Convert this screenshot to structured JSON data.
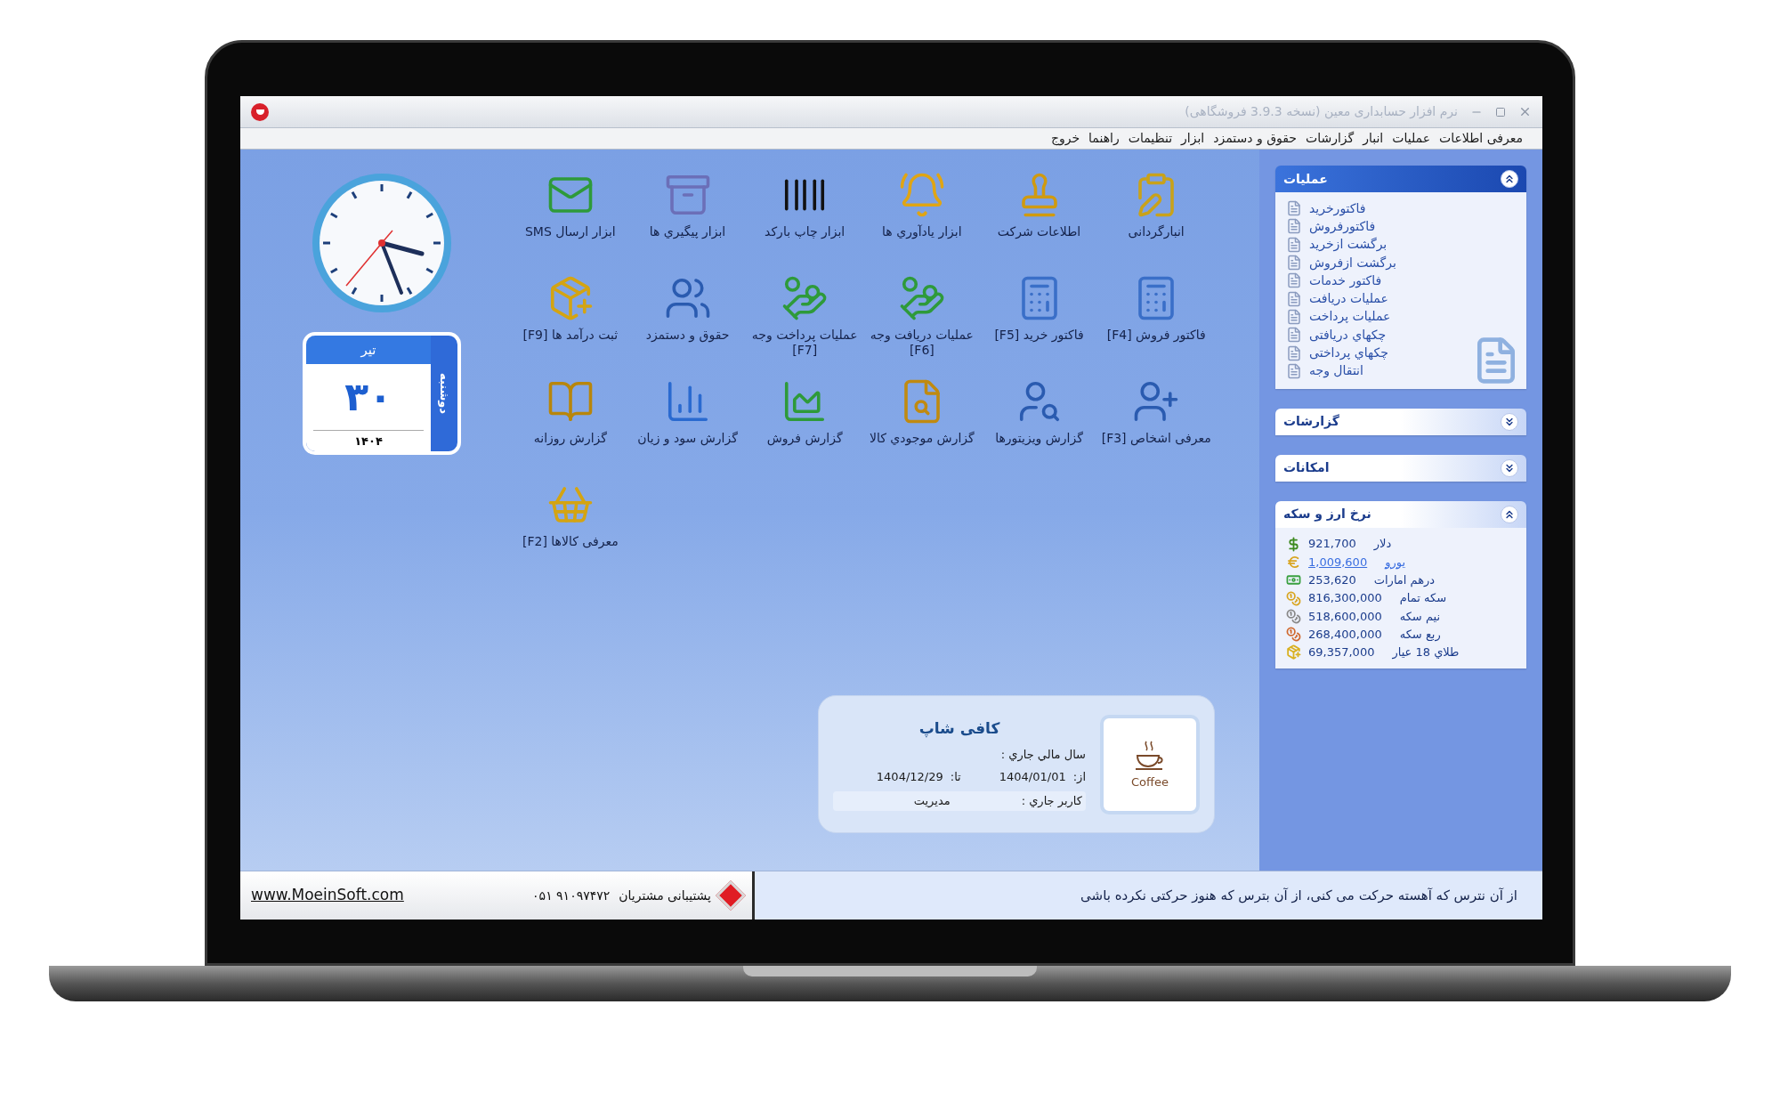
{
  "window": {
    "title": "نرم افزار حسابداری معین (نسخه 3.9.3 فروشگاهی)"
  },
  "menu": [
    "معرفی اطلاعات",
    "عملیات",
    "انبار",
    "گزارشات",
    "حقوق و دستمزد",
    "ابزار",
    "تنظیمات",
    "راهنما",
    "خروج"
  ],
  "shortcuts": [
    {
      "label": "انبارگردانی"
    },
    {
      "label": "اطلاعات شرکت"
    },
    {
      "label": "ابزار يادآوري ها"
    },
    {
      "label": "ابزار چاپ بارکد"
    },
    {
      "label": "ابزار پیگیري ها"
    },
    {
      "label": "ابزار ارسال SMS"
    },
    {
      "label": "فاکتور فروش [F4]"
    },
    {
      "label": "فاکتور خرید [F5]"
    },
    {
      "label": "عملیات دریافت وجه [F6]"
    },
    {
      "label": "عملیات پرداخت وجه [F7]"
    },
    {
      "label": "حقوق و دستمزد"
    },
    {
      "label": "ثبت درآمد ها [F9]"
    },
    {
      "label": "معرفی اشخاص [F3]"
    },
    {
      "label": "گزارش ویزیتورها"
    },
    {
      "label": "گزارش موجودي کالا"
    },
    {
      "label": "گزارش فروش"
    },
    {
      "label": "گزارش سود و زیان"
    },
    {
      "label": "گزارش روزانه"
    },
    {
      "label": "معرفی کالاها [F2]"
    }
  ],
  "calendar": {
    "month": "تیر",
    "day": "۳۰",
    "year": "۱۴۰۴",
    "weekday": "دوشنبه"
  },
  "company_card": {
    "name": "کافی شاپ",
    "fiscal_year_label": "سال مالي جاري :",
    "from_label": "از:",
    "from_date": "1404/01/01",
    "to_label": "تا:",
    "to_date": "1404/12/29",
    "user_label": "کاربر جاري :",
    "user": "مدیریت",
    "logo_text": "Coffee"
  },
  "sidebar": {
    "panels": [
      {
        "kind": "links",
        "title": "عملیات",
        "expanded": true,
        "items": [
          "فاکتورخرید",
          "فاکتورفروش",
          "برگشت ازخرید",
          "برگشت ازفروش",
          "فاکتور خدمات",
          "عملیات دریافت",
          "عملیات پرداخت",
          "چکهاي دریافتی",
          "چکهاي پرداختی",
          "انتقال وجه"
        ]
      },
      {
        "kind": "links",
        "title": "گزارشات",
        "expanded": false
      },
      {
        "kind": "links",
        "title": "امکانات",
        "expanded": false
      },
      {
        "kind": "rates",
        "title": "نرخ ارز و سکه",
        "expanded": true,
        "rates": [
          {
            "name": "دلار",
            "value": "921,700",
            "hovered": false
          },
          {
            "name": "یورو",
            "value": "1,009,600",
            "hovered": true
          },
          {
            "name": "درهم امارات",
            "value": "253,620",
            "hovered": false
          },
          {
            "name": "سکه تمام",
            "value": "816,300,000",
            "hovered": false
          },
          {
            "name": "نیم سکه",
            "value": "518,600,000",
            "hovered": false
          },
          {
            "name": "ربع سکه",
            "value": "268,400,000",
            "hovered": false
          },
          {
            "name": "طلاي 18 عیار",
            "value": "69,357,000",
            "hovered": false
          }
        ]
      }
    ]
  },
  "footer": {
    "quote": "از آن نترس که آهسته حرکت می کنی، از آن بترس که هنوز حرکتی نکرده باشی",
    "support_label": "پشتیبانی مشتریان",
    "phone": "۰۵۱ ۹۱۰۹۷۴۷۲",
    "website": "www.MoeinSoft.com"
  }
}
